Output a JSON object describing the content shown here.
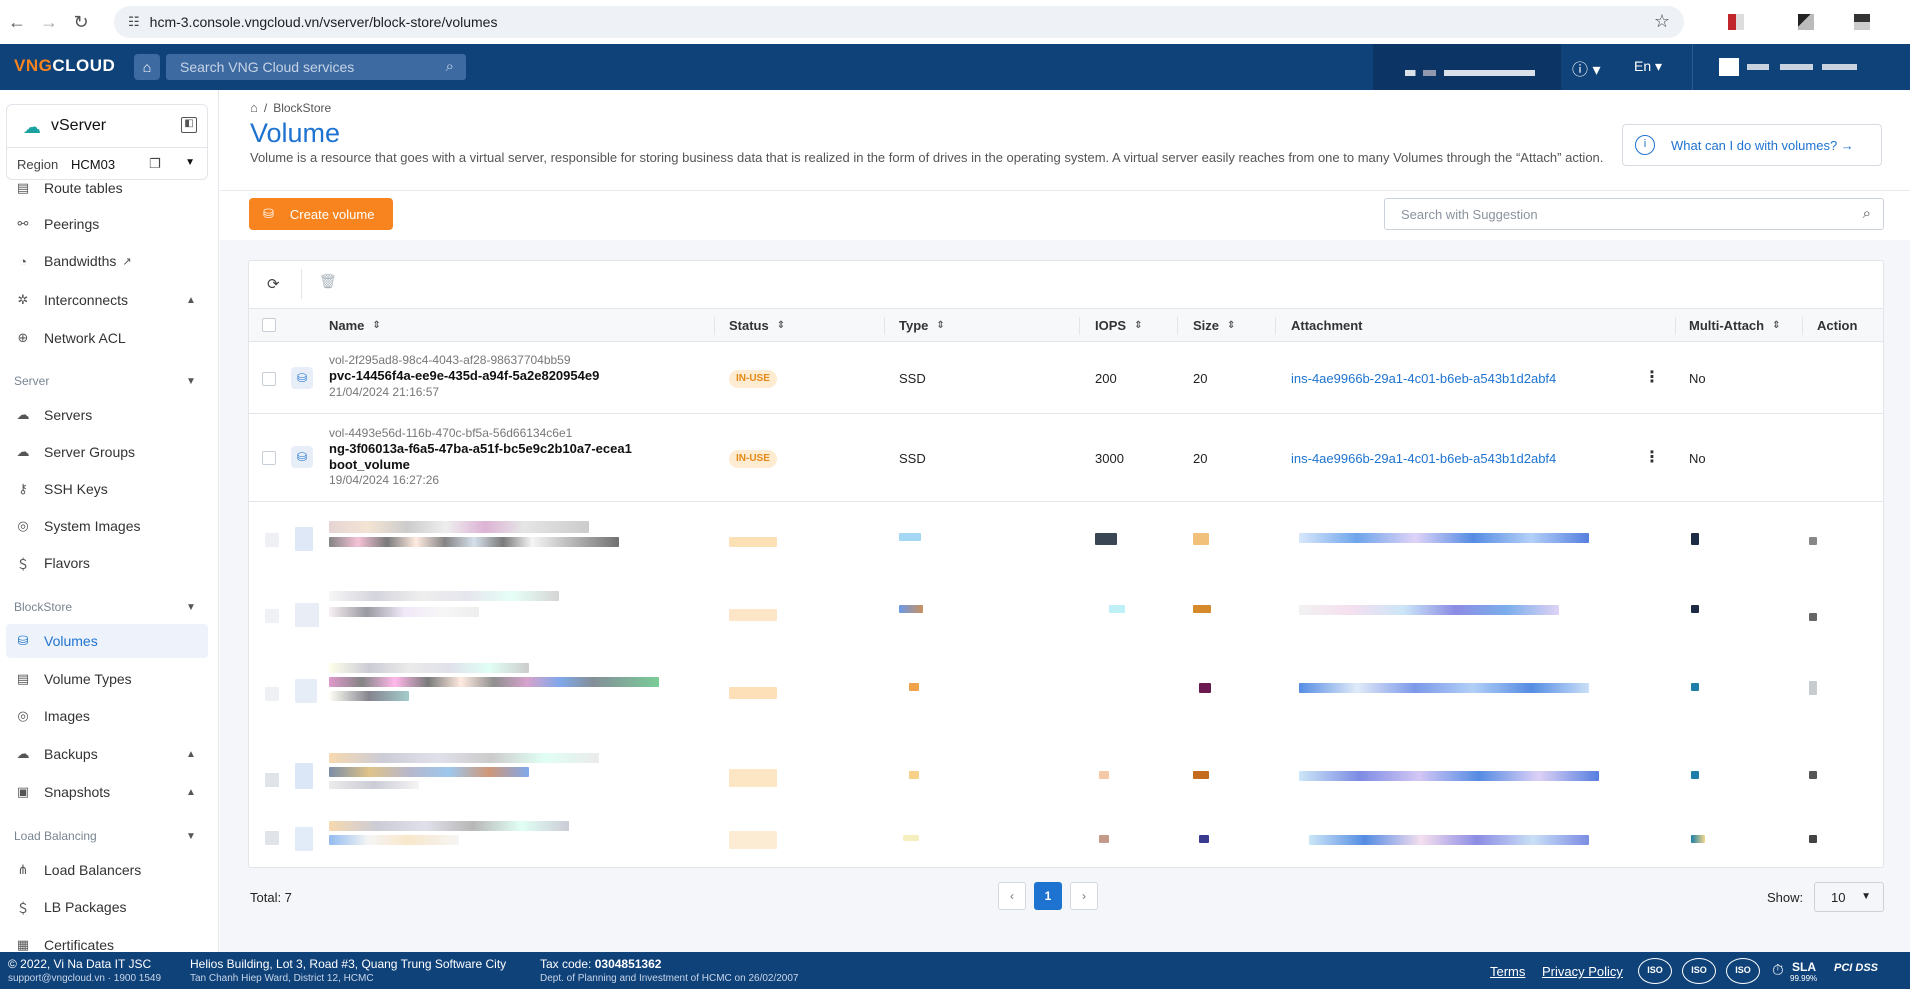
{
  "browser": {
    "url": "hcm-3.console.vngcloud.vn/vserver/block-store/volumes"
  },
  "header": {
    "logo_prefix": "VNG",
    "logo_suffix": "CLOUD",
    "search_placeholder": "Search VNG Cloud services",
    "language": "En"
  },
  "sidebar": {
    "service_name": "vServer",
    "region_label": "Region",
    "region_value": "HCM03",
    "items": [
      {
        "label": "Route tables",
        "icon": "route-table-icon"
      },
      {
        "label": "Peerings",
        "icon": "peering-icon"
      },
      {
        "label": "Bandwidths",
        "icon": "bandwidth-icon",
        "external": true
      },
      {
        "label": "Interconnects",
        "icon": "interconnect-icon"
      },
      {
        "label": "Network ACL",
        "icon": "network-acl-icon"
      }
    ],
    "section_server": "Server",
    "server_items": [
      {
        "label": "Servers"
      },
      {
        "label": "Server Groups"
      },
      {
        "label": "SSH Keys"
      },
      {
        "label": "System Images"
      },
      {
        "label": "Flavors"
      }
    ],
    "section_blockstore": "BlockStore",
    "blockstore_items": [
      {
        "label": "Volumes"
      },
      {
        "label": "Volume Types"
      },
      {
        "label": "Images"
      },
      {
        "label": "Backups"
      },
      {
        "label": "Snapshots"
      }
    ],
    "section_lb": "Load Balancing",
    "lb_items": [
      {
        "label": "Load Balancers"
      },
      {
        "label": "LB Packages"
      },
      {
        "label": "Certificates"
      }
    ]
  },
  "main": {
    "breadcrumb": "BlockStore",
    "title": "Volume",
    "description": "Volume is a resource that goes with a virtual server, responsible for storing business data that is realized in the form of drives in the operating system. A virtual server easily reaches from one to many Volumes through the “Attach” action.",
    "help_link": "What can I do with volumes? →",
    "create_button": "Create volume",
    "search_placeholder": "Search with Suggestion"
  },
  "table": {
    "columns": {
      "name": "Name",
      "status": "Status",
      "type": "Type",
      "iops": "IOPS",
      "size": "Size",
      "attachment": "Attachment",
      "multi_attach": "Multi-Attach",
      "action": "Action"
    },
    "rows": [
      {
        "id": "vol-2f295ad8-98c4-4043-af28-98637704bb59",
        "name": "pvc-14456f4a-ee9e-435d-a94f-5a2e820954e9",
        "name2": "",
        "date": "21/04/2024 21:16:57",
        "status": "IN-USE",
        "type": "SSD",
        "iops": "200",
        "size": "20",
        "attachment": "ins-4ae9966b-29a1-4c01-b6eb-a543b1d2abf4",
        "multi_attach": "No"
      },
      {
        "id": "vol-4493e56d-116b-470c-bf5a-56d66134c6e1",
        "name": "ng-3f06013a-f6a5-47ba-a51f-bc5e9c2b10a7-ecea1",
        "name2": "boot_volume",
        "date": "19/04/2024 16:27:26",
        "status": "IN-USE",
        "type": "SSD",
        "iops": "3000",
        "size": "20",
        "attachment": "ins-4ae9966b-29a1-4c01-b6eb-a543b1d2abf4",
        "multi_attach": "No"
      }
    ]
  },
  "pagination": {
    "total": "Total: 7",
    "prev": "‹",
    "page": "1",
    "next": "›",
    "show_label": "Show:",
    "show_value": "10"
  },
  "footer": {
    "company": "© 2022, Vi Na Data IT JSC",
    "contact": "support@vngcloud.vn · 1900 1549",
    "address": "Helios Building, Lot 3, Road #3, Quang Trung Software City",
    "address2": "Tan Chanh Hiep Ward, District 12, HCMC",
    "tax_label": "Tax code:",
    "tax_code": "0304851362",
    "tax_dept": "Dept. of Planning and Investment of HCMC on 26/02/2007",
    "terms": "Terms",
    "privacy": "Privacy Policy",
    "cert_iso": "ISO",
    "cert_sla": "SLA",
    "cert_sla_value": "99.99%",
    "cert_pci": "PCI DSS"
  },
  "colors": {
    "brand_blue": "#10427a",
    "accent_orange": "#f7841e",
    "link_blue": "#1e73d1"
  }
}
